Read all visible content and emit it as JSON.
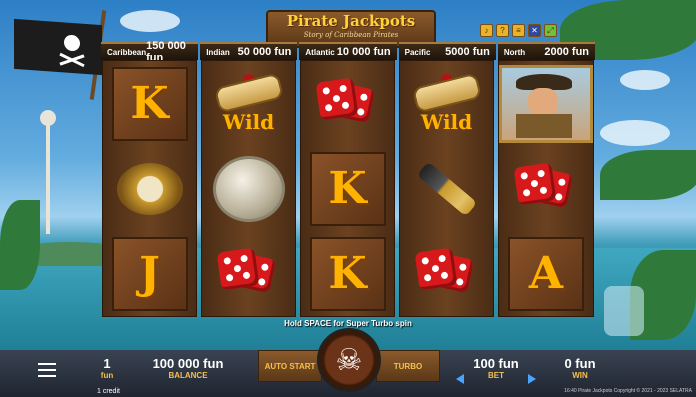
{
  "game": {
    "title": "Pirate Jackpots",
    "subtitle": "Story of Caribbean Pirates"
  },
  "jackpots": [
    {
      "name": "Caribbean",
      "value": "150 000 fun"
    },
    {
      "name": "Indian",
      "value": "50 000 fun"
    },
    {
      "name": "Atlantic",
      "value": "10 000 fun"
    },
    {
      "name": "Pacific",
      "value": "5000 fun"
    },
    {
      "name": "North",
      "value": "2000 fun"
    }
  ],
  "reels": [
    [
      "K",
      "compass",
      "J"
    ],
    [
      "wild-scroll",
      "coin",
      "dice"
    ],
    [
      "dice",
      "K",
      "K"
    ],
    [
      "wild-scroll",
      "spyglass",
      "dice"
    ],
    [
      "pirate-portrait",
      "dice",
      "A"
    ]
  ],
  "wild_label": "Wild",
  "hint": "Hold SPACE for Super Turbo spin",
  "bottom_bar": {
    "lines_value": "1",
    "lines_unit": "fun",
    "balance_value": "100 000 fun",
    "balance_label": "BALANCE",
    "auto_start_label": "AUTO START",
    "turbo_label": "TURBO",
    "bet_value": "100 fun",
    "bet_label": "BET",
    "win_value": "0 fun",
    "win_label": "WIN",
    "credit_text": "1 credit",
    "copyright": "16:40 Pirate Jackpots Copyright © 2021 - 2023 SELATRA"
  },
  "colors": {
    "accent": "#f6c04a",
    "letter": "#ffb300",
    "dice": "#d8191b",
    "wood": "#6b4220"
  }
}
